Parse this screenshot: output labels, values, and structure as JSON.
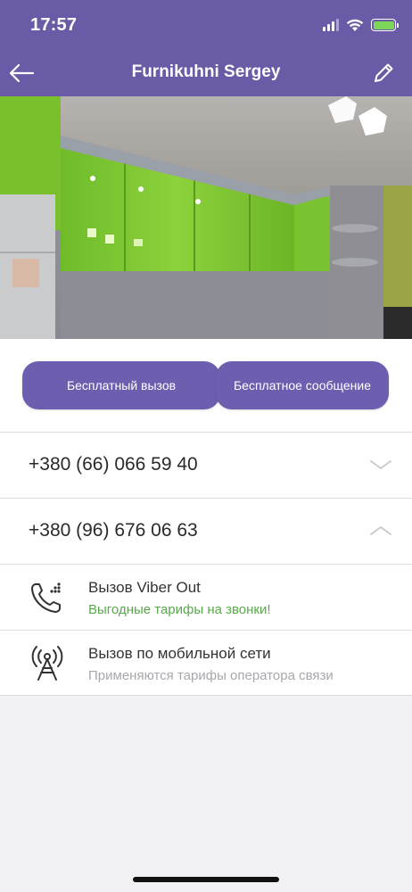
{
  "status_bar": {
    "time": "17:57",
    "signal_icon": "cellular-signal-icon",
    "wifi_icon": "wifi-icon",
    "battery_icon": "battery-charging-icon",
    "battery_level_fraction": 1.0
  },
  "header": {
    "back_icon": "arrow-left-icon",
    "title": "Furnikuhni Sergey",
    "edit_icon": "pencil-icon",
    "background_color": "#6b5aa6"
  },
  "photo": {
    "description_icon": "contact-photo"
  },
  "actions": {
    "free_call_label": "Бесплатный вызов",
    "free_message_label": "Бесплатное сообщение",
    "button_color": "#6d5eaf"
  },
  "phones": [
    {
      "number": "+380 (66) 066 59 40",
      "expanded": false,
      "chevron_icon": "chevron-down-icon"
    },
    {
      "number": "+380 (96) 676 06 63",
      "expanded": true,
      "chevron_icon": "chevron-up-icon"
    }
  ],
  "call_options": [
    {
      "icon": "viber-out-phone-icon",
      "title": "Вызов Viber Out",
      "subtitle": "Выгодные тарифы на звонки!",
      "subtitle_color": "#58a94a"
    },
    {
      "icon": "cell-tower-icon",
      "title": "Вызов по мобильной сети",
      "subtitle": "Применяются тарифы оператора связи",
      "subtitle_color": "#a7a7ad"
    }
  ]
}
